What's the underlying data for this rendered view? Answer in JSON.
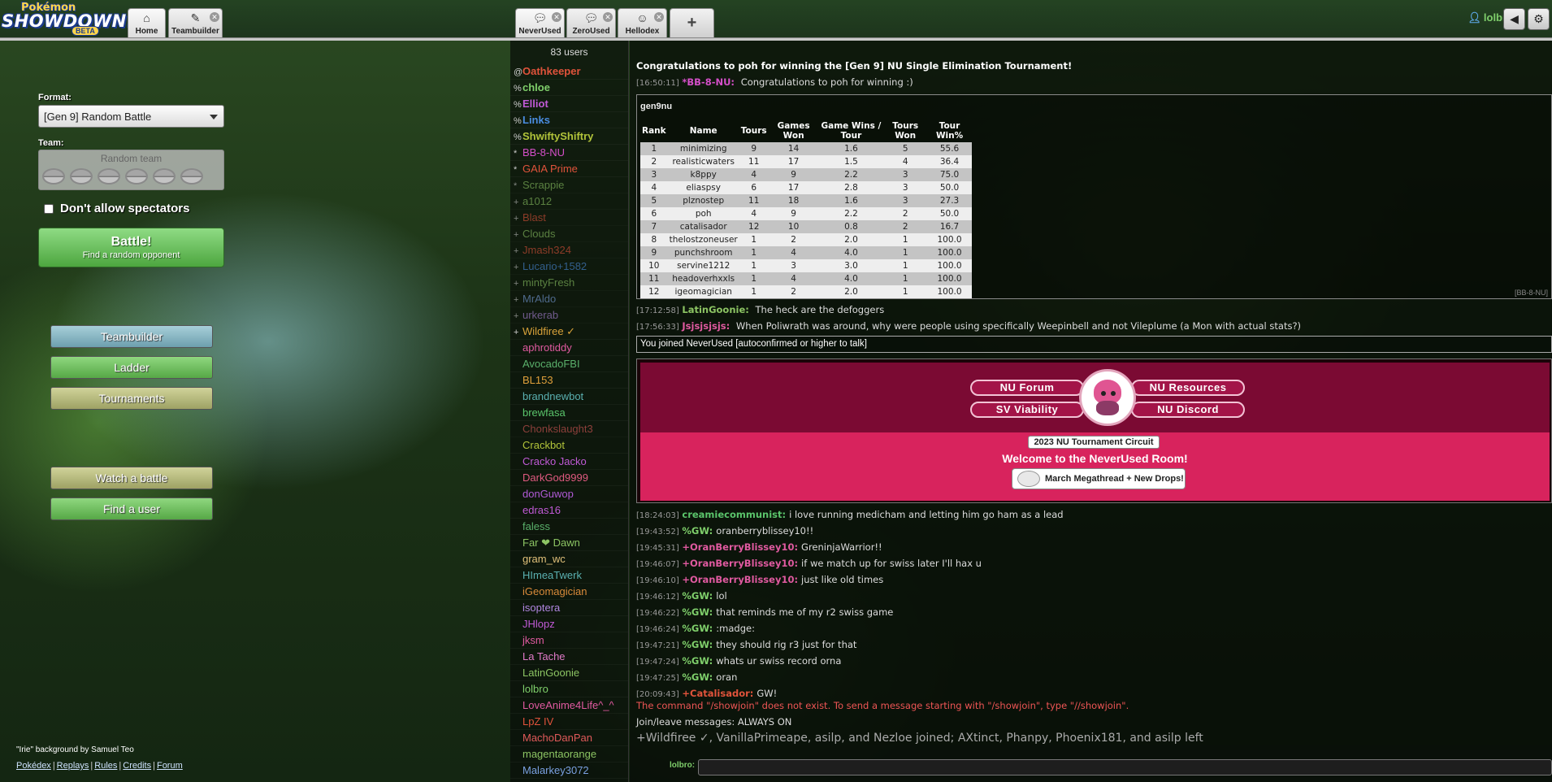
{
  "header": {
    "logo": {
      "line1": "Pokémon",
      "line2": "SHOWDOWN!",
      "line3": "BETA"
    },
    "tabs_left": [
      {
        "label": "Home",
        "icon": "home-icon"
      },
      {
        "label": "Teambuilder",
        "icon": "edit-icon"
      }
    ],
    "tabs_rooms": [
      {
        "label": "NeverUsed",
        "icon": "chat-bubble-icon"
      },
      {
        "label": "ZeroUsed",
        "icon": "chat-bubble-icon"
      },
      {
        "label": "Hellodex",
        "icon": "smile-icon"
      }
    ],
    "plus_label": "+",
    "username": "lolbro",
    "volume_icon": "◀",
    "settings_icon": "⚙"
  },
  "mainmenu": {
    "format_label": "Format:",
    "format_value": "[Gen 9] Random Battle",
    "team_label": "Team:",
    "team_value": "Random team",
    "spectators_label": "Don't allow spectators",
    "battle_title": "Battle!",
    "battle_subtitle": "Find a random opponent",
    "buttons": {
      "teambuilder": "Teambuilder",
      "ladder": "Ladder",
      "tournaments": "Tournaments",
      "watch": "Watch a battle",
      "finduser": "Find a user"
    },
    "credit": "\"Irie\" background by Samuel Teo",
    "footer": [
      "Pokédex",
      "Replays",
      "Rules",
      "Credits",
      "Forum"
    ]
  },
  "userlist": {
    "count": "83 users",
    "users": [
      {
        "rank": "@",
        "name": "Oathkeeper",
        "color": "#e0533b",
        "bold": true
      },
      {
        "rank": "%",
        "name": "chloe",
        "color": "#7fcf6b",
        "bold": true
      },
      {
        "rank": "%",
        "name": "Elliot",
        "color": "#c05ad6",
        "bold": true
      },
      {
        "rank": "%",
        "name": "Links",
        "color": "#4a8ce0",
        "bold": true
      },
      {
        "rank": "%",
        "name": "ShwiftyShiftry",
        "color": "#b2c43a",
        "bold": true
      },
      {
        "rank": "*",
        "name": "BB-8-NU",
        "color": "#d44fc8"
      },
      {
        "rank": "*",
        "name": "GAIA Prime",
        "color": "#e0533b"
      },
      {
        "rank": "*",
        "name": "Scrappie",
        "color": "#8cc463",
        "dim": true
      },
      {
        "rank": "+",
        "name": "a1012",
        "color": "#8cc463",
        "dim": true
      },
      {
        "rank": "+",
        "name": "Blast",
        "color": "#e0533b",
        "dim": true
      },
      {
        "rank": "+",
        "name": "Clouds",
        "color": "#8cc463",
        "dim": true
      },
      {
        "rank": "+",
        "name": "Jmash324",
        "color": "#e0533b",
        "dim": true
      },
      {
        "rank": "+",
        "name": "Lucario+1582",
        "color": "#4a8ce0",
        "dim": true
      },
      {
        "rank": "+",
        "name": "mintyFresh",
        "color": "#8cc463",
        "dim": true
      },
      {
        "rank": "+",
        "name": "MrAldo",
        "color": "#7aa0e0",
        "dim": true
      },
      {
        "rank": "+",
        "name": "urkerab",
        "color": "#b086e0",
        "dim": true
      },
      {
        "rank": "+",
        "name": "Wildfiree ✓",
        "color": "#d9a23a"
      },
      {
        "rank": "",
        "name": "aphrotiddy",
        "color": "#e05aa0"
      },
      {
        "rank": "",
        "name": "AvocadoFBI",
        "color": "#5ab06b"
      },
      {
        "rank": "",
        "name": "BL153",
        "color": "#e0a03b"
      },
      {
        "rank": "",
        "name": "brandnewbot",
        "color": "#5ab0b0"
      },
      {
        "rank": "",
        "name": "brewfasa",
        "color": "#5ac46b"
      },
      {
        "rank": "",
        "name": "Chonkslaught3",
        "color": "#e05a5a",
        "dim": true
      },
      {
        "rank": "",
        "name": "Crackbot",
        "color": "#b2c43a"
      },
      {
        "rank": "",
        "name": "Cracko Jacko",
        "color": "#c05ad6"
      },
      {
        "rank": "",
        "name": "DarkGod9999",
        "color": "#e05a80"
      },
      {
        "rank": "",
        "name": "donGuwop",
        "color": "#b05ad6"
      },
      {
        "rank": "",
        "name": "edras16",
        "color": "#c05ad6"
      },
      {
        "rank": "",
        "name": "faless",
        "color": "#5ab06b"
      },
      {
        "rank": "",
        "name": "Far ❤ Dawn",
        "color": "#8cc463"
      },
      {
        "rank": "",
        "name": "gram_wc",
        "color": "#e0c07a"
      },
      {
        "rank": "",
        "name": "HImeaTwerk",
        "color": "#5ab0b0"
      },
      {
        "rank": "",
        "name": "iGeomagician",
        "color": "#d98a3a"
      },
      {
        "rank": "",
        "name": "isoptera",
        "color": "#b086e0"
      },
      {
        "rank": "",
        "name": "JHlopz",
        "color": "#c05ad6"
      },
      {
        "rank": "",
        "name": "jksm",
        "color": "#e05aa0"
      },
      {
        "rank": "",
        "name": "La Tache",
        "color": "#e07ac8"
      },
      {
        "rank": "",
        "name": "LatinGoonie",
        "color": "#8cc463"
      },
      {
        "rank": "",
        "name": "lolbro",
        "color": "#7fcf6b"
      },
      {
        "rank": "",
        "name": "LoveAnime4Life^_^",
        "color": "#e05aa0"
      },
      {
        "rank": "",
        "name": "LpZ IV",
        "color": "#e0533b"
      },
      {
        "rank": "",
        "name": "MachoDanPan",
        "color": "#e05a5a"
      },
      {
        "rank": "",
        "name": "magentaorange",
        "color": "#8cc463"
      },
      {
        "rank": "",
        "name": "Malarkey3072",
        "color": "#7aa0e0"
      }
    ]
  },
  "chat": {
    "announce": "Congratulations to poh for winning the [Gen 9] NU Single Elimination Tournament!",
    "msg1": {
      "ts": "[16:50:11]",
      "author": "*BB-8-NU:",
      "text": "Congratulations to poh for winning :)"
    },
    "tour": {
      "title": "gen9nu",
      "signature": "[BB-8-NU]",
      "headers": [
        "Rank",
        "Name",
        "Tours",
        "Games Won",
        "Game Wins / Tour",
        "Tours Won",
        "Tour Win%"
      ],
      "rows": [
        [
          "1",
          "minimizing",
          "9",
          "14",
          "1.6",
          "5",
          "55.6"
        ],
        [
          "2",
          "realisticwaters",
          "11",
          "17",
          "1.5",
          "4",
          "36.4"
        ],
        [
          "3",
          "k8ppy",
          "4",
          "9",
          "2.2",
          "3",
          "75.0"
        ],
        [
          "4",
          "eliaspsy",
          "6",
          "17",
          "2.8",
          "3",
          "50.0"
        ],
        [
          "5",
          "plznostep",
          "11",
          "18",
          "1.6",
          "3",
          "27.3"
        ],
        [
          "6",
          "poh",
          "4",
          "9",
          "2.2",
          "2",
          "50.0"
        ],
        [
          "7",
          "catalisador",
          "12",
          "10",
          "0.8",
          "2",
          "16.7"
        ],
        [
          "8",
          "thelostzoneuser",
          "1",
          "2",
          "2.0",
          "1",
          "100.0"
        ],
        [
          "9",
          "punchshroom",
          "1",
          "4",
          "4.0",
          "1",
          "100.0"
        ],
        [
          "10",
          "servine1212",
          "1",
          "3",
          "3.0",
          "1",
          "100.0"
        ],
        [
          "11",
          "headoverhxxls",
          "1",
          "4",
          "4.0",
          "1",
          "100.0"
        ],
        [
          "12",
          "igeomagician",
          "1",
          "2",
          "2.0",
          "1",
          "100.0"
        ]
      ]
    },
    "msg2": {
      "ts": "[17:12:58]",
      "author": "LatinGoonie:",
      "text": "The heck are the defoggers"
    },
    "msg3": {
      "ts": "[17:56:33]",
      "author": "Jsjsjsjsjs:",
      "text": "When Poliwrath was around, why were people using specifically Weepinbell and not Vileplume (a Mon with actual stats?)"
    },
    "joined": "You joined NeverUsed [autoconfirmed or higher to talk]",
    "intro": {
      "pill1": "NU Forum",
      "pill2": "NU Resources",
      "pill3": "SV Viability",
      "pill4": "NU Discord",
      "circuit": "2023 NU Tournament Circuit",
      "welcome": "Welcome to the NeverUsed Room!",
      "mega": "March Megathread + New Drops!"
    },
    "lines": [
      {
        "ts": "[18:24:03]",
        "author": "creamiecommunist:",
        "color": "#5ac46b",
        "text": "i love running medicham and letting him go ham as a lead"
      },
      {
        "ts": "[19:43:52]",
        "author": "%GW:",
        "color": "#7fcf6b",
        "text": "oranberryblissey10!!"
      },
      {
        "ts": "[19:45:31]",
        "author": "+OranBerryBlissey10:",
        "color": "#e05aa0",
        "text": "GreninjaWarrior!!"
      },
      {
        "ts": "[19:46:07]",
        "author": "+OranBerryBlissey10:",
        "color": "#e05aa0",
        "text": "if we match up for swiss later I'll hax u"
      },
      {
        "ts": "[19:46:10]",
        "author": "+OranBerryBlissey10:",
        "color": "#e05aa0",
        "text": "just like old times"
      },
      {
        "ts": "[19:46:12]",
        "author": "%GW:",
        "color": "#7fcf6b",
        "text": "lol"
      },
      {
        "ts": "[19:46:22]",
        "author": "%GW:",
        "color": "#7fcf6b",
        "text": "that reminds me of my r2 swiss game"
      },
      {
        "ts": "[19:46:24]",
        "author": "%GW:",
        "color": "#7fcf6b",
        "text": ":madge:"
      },
      {
        "ts": "[19:47:21]",
        "author": "%GW:",
        "color": "#7fcf6b",
        "text": "they should rig r3 just for that"
      },
      {
        "ts": "[19:47:24]",
        "author": "%GW:",
        "color": "#7fcf6b",
        "text": "whats ur swiss record orna"
      },
      {
        "ts": "[19:47:25]",
        "author": "%GW:",
        "color": "#7fcf6b",
        "text": "oran"
      },
      {
        "ts": "[20:09:43]",
        "author": "+Catalisador:",
        "color": "#e0533b",
        "text": "GW!"
      }
    ],
    "error": "The command \"/showjoin\" does not exist. To send a message starting with \"/showjoin\", type \"//showjoin\".",
    "joinleave": "Join/leave messages: ALWAYS ON",
    "joinsummary": "+Wildfiree ✓, VanillaPrimeape, asilp, and Nezloe joined; AXtinct, Phanpy, Phoenix181, and asilp left",
    "input_user": "lolbro:"
  }
}
